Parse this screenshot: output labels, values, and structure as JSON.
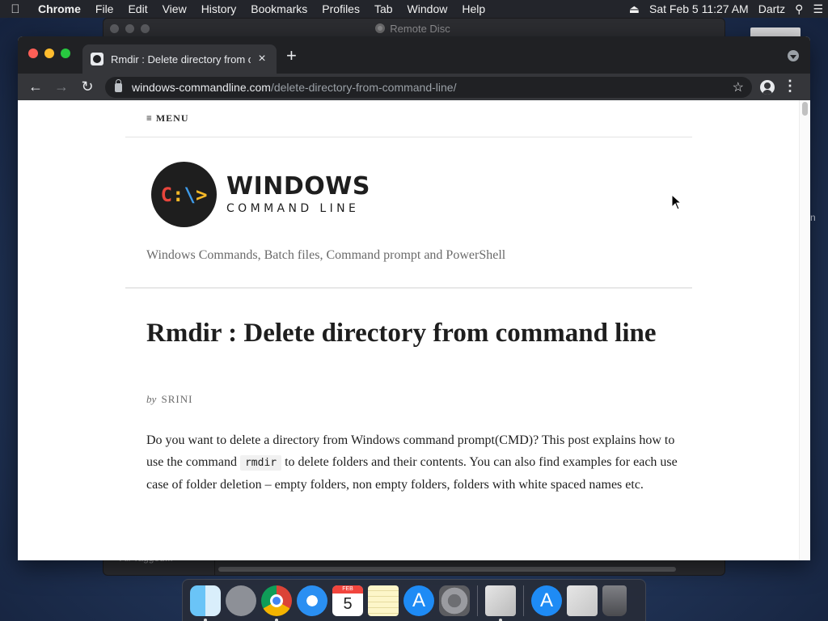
{
  "menubar": {
    "app_name": "Chrome",
    "items": [
      "File",
      "Edit",
      "View",
      "History",
      "Bookmarks",
      "Profiles",
      "Tab",
      "Window",
      "Help"
    ],
    "datetime": "Sat Feb 5  11:27 AM",
    "user": "Dartz"
  },
  "background_window": {
    "title": "Remote Disc",
    "sidebar_item": "All Tagged..."
  },
  "browser": {
    "tab_title": "Rmdir : Delete directory from c",
    "url_host": "windows-commandline.com",
    "url_path": "/delete-directory-from-command-line/"
  },
  "page": {
    "menu_label": "≡ MENU",
    "logo_word_1": "WINDOWS",
    "logo_word_2": "COMMAND LINE",
    "logo_symbol": "C:\\>",
    "tagline": "Windows Commands, Batch files, Command prompt and PowerShell",
    "post_title": "Rmdir : Delete directory from command line",
    "byline_prefix": "by",
    "author": "SRINI",
    "intro_part1": "Do you want to delete a directory from Windows command prompt(CMD)? This post explains how to use the command ",
    "intro_code": "rmdir",
    "intro_part2": " to delete folders and their contents. You can also find examples for each use case of folder deletion – empty folders, non empty folders, folders with white spaced names etc."
  },
  "desktop": {
    "partial_label": "n"
  },
  "dock": {
    "calendar_month": "FEB",
    "calendar_day": "5"
  },
  "colors": {
    "logo_red": "#e8453c",
    "logo_blue": "#3e9be9",
    "logo_yellow": "#f6b928"
  }
}
